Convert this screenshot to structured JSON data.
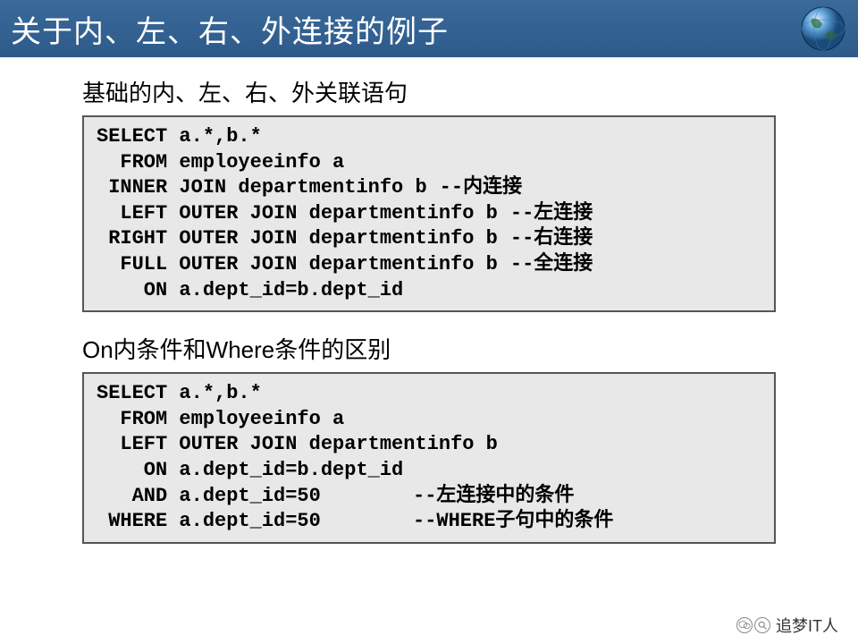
{
  "header": {
    "title": "关于内、左、右、外连接的例子"
  },
  "section1": {
    "title": "基础的内、左、右、外关联语句",
    "lines": {
      "l1": "SELECT a.*,b.*",
      "l2": "  FROM employeeinfo a",
      "l3": " INNER JOIN departmentinfo b",
      "l3c": "--内连接",
      "l4": "  LEFT OUTER JOIN departmentinfo b",
      "l4c": "--左连接",
      "l5": " RIGHT OUTER JOIN departmentinfo b",
      "l5c": "--右连接",
      "l6": "  FULL OUTER JOIN departmentinfo b",
      "l6c": "--全连接",
      "l7": "    ON a.dept_id=b.dept_id"
    }
  },
  "section2": {
    "title": "On内条件和Where条件的区别",
    "lines": {
      "l1": "SELECT a.*,b.*",
      "l2": "  FROM employeeinfo a",
      "l3": "  LEFT OUTER JOIN departmentinfo b",
      "l4": "    ON a.dept_id=b.dept_id",
      "l5": "   AND a.dept_id=50",
      "l5c": "--左连接中的条件",
      "l6": " WHERE a.dept_id=50",
      "l6c": "--WHERE子句中的条件"
    }
  },
  "footer": {
    "text": "追梦IT人"
  }
}
